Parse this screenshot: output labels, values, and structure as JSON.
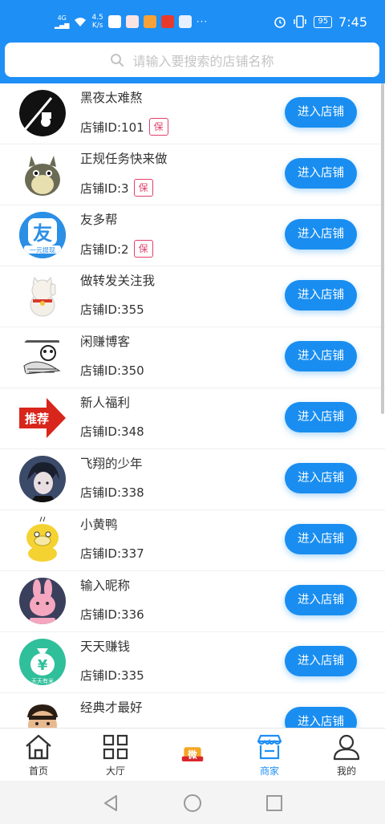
{
  "status_bar": {
    "network": "4G",
    "speed_value": "4.5",
    "speed_unit": "K/s",
    "battery": "95",
    "time": "7:45"
  },
  "search": {
    "placeholder": "请输入要搜索的店铺名称"
  },
  "shops": [
    {
      "name": "黑夜太难熬",
      "id_text": "店铺ID:101",
      "badge": "保",
      "button": "进入店铺",
      "avatar": "black-logo"
    },
    {
      "name": "正规任务快来做",
      "id_text": "店铺ID:3",
      "badge": "保",
      "button": "进入店铺",
      "avatar": "totoro"
    },
    {
      "name": "友多帮",
      "id_text": "店铺ID:2",
      "badge": "保",
      "button": "进入店铺",
      "avatar": "you-logo",
      "avatar_text": "友",
      "avatar_subtext": "一元提现"
    },
    {
      "name": "做转发关注我",
      "id_text": "店铺ID:355",
      "badge": "",
      "button": "进入店铺",
      "avatar": "lucky-cat"
    },
    {
      "name": "闲赚博客",
      "id_text": "店铺ID:350",
      "badge": "",
      "button": "进入店铺",
      "avatar": "panda-meme"
    },
    {
      "name": "新人福利",
      "id_text": "店铺ID:348",
      "badge": "",
      "button": "进入店铺",
      "avatar": "recommend-arrow",
      "avatar_text": "推荐"
    },
    {
      "name": "飞翔的少年",
      "id_text": "店铺ID:338",
      "badge": "",
      "button": "进入店铺",
      "avatar": "anime-boy"
    },
    {
      "name": "小黄鸭",
      "id_text": "店铺ID:337",
      "badge": "",
      "button": "进入店铺",
      "avatar": "yellow-duck"
    },
    {
      "name": "输入昵称",
      "id_text": "店铺ID:336",
      "badge": "",
      "button": "进入店铺",
      "avatar": "pink-rabbit"
    },
    {
      "name": "天天赚钱",
      "id_text": "店铺ID:335",
      "badge": "",
      "button": "进入店铺",
      "avatar": "money-bag",
      "avatar_text": "¥",
      "avatar_subtext": "天天有米"
    },
    {
      "name": "经典才最好",
      "id_text": "",
      "badge": "",
      "button": "进入店铺",
      "avatar": "cartoon-face"
    }
  ],
  "bottom_nav": [
    {
      "label": "首页",
      "icon": "home-icon"
    },
    {
      "label": "大厅",
      "icon": "grid-icon"
    },
    {
      "label": "",
      "icon": "wei-badge-icon",
      "icon_text": "微"
    },
    {
      "label": "商家",
      "icon": "store-icon",
      "active": true
    },
    {
      "label": "我的",
      "icon": "user-icon"
    }
  ],
  "colors": {
    "primary": "#1e8ff5",
    "button": "#1a8ef0",
    "badge": "#e2406a",
    "text": "#333333"
  }
}
